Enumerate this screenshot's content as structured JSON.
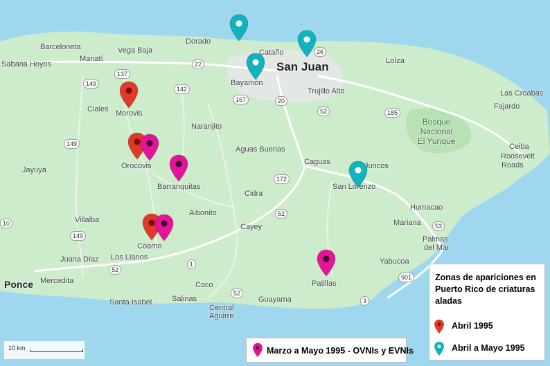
{
  "colors": {
    "sea": "#9fd8ee",
    "land": "#cdeccb",
    "road_major": "#ffffff",
    "road_minor": "#e8e8e8",
    "urban": "#e3e8e4",
    "pin_red": "#e0392b",
    "pin_magenta": "#e4139a",
    "pin_cyan": "#12b3c0"
  },
  "places": {
    "barceloneta": "Barceloneta",
    "vega_baja": "Vega Baja",
    "dorado": "Dorado",
    "manati": "Manatí",
    "sabana_hoyos": "Sabana Hoyos",
    "catano": "Cataño",
    "san_juan": "San Juan",
    "loiza": "Loíza",
    "bayamon": "Bayamón",
    "trujillo_alto": "Trujillo Alto",
    "las_croabas": "Las Croabas",
    "ciales": "Ciales",
    "morovis": "Morovis",
    "fajardo": "Fajardo",
    "naranjito": "Naranjito",
    "bosque_1": "Bosque",
    "bosque_2": "Nacional",
    "bosque_3": "El Yunque",
    "ceiba": "Ceiba",
    "roosevelt_1": "Roosevelt",
    "roosevelt_2": "Roads",
    "jayuya": "Jayuya",
    "orocovis": "Orocovis",
    "aguas_buenas": "Aguas Buenas",
    "caguas": "Caguas",
    "juncos": "Juncos",
    "barranquitas": "Barranquitas",
    "san_lorenzo": "San Lorenzo",
    "cidra": "Cidra",
    "aibonito": "Aibonito",
    "humacao": "Humacao",
    "villalba": "Villalba",
    "cayey": "Cayey",
    "mariana": "Mariana",
    "coamo": "Coamo",
    "palmas_1": "Palmas",
    "palmas_2": "del Mar",
    "juana_diaz": "Juana Díaz",
    "los_llanos": "Los Llanos",
    "yabucoa": "Yabucoa",
    "ponce": "Ponce",
    "mercedita": "Mercedita",
    "coco": "Coco",
    "patillas": "Patillas",
    "santa_isabel": "Santa Isabel",
    "salinas": "Salinas",
    "guayama": "Guayama",
    "central_1": "Central",
    "central_2": "Aguirre"
  },
  "shields": [
    "22",
    "26",
    "137",
    "149",
    "142",
    "167",
    "20",
    "52",
    "185",
    "149",
    "172",
    "52",
    "149",
    "52",
    "1",
    "53",
    "901",
    "3",
    "52",
    "10"
  ],
  "pins": {
    "red": [
      {
        "place": "Morovis",
        "period": "Abril 1995"
      },
      {
        "place": "Orocovis",
        "period": "Abril 1995"
      },
      {
        "place": "Coamo",
        "period": "Abril 1995"
      }
    ],
    "magenta": [
      {
        "place": "Orocovis",
        "period": "Marzo a Mayo 1995"
      },
      {
        "place": "Barranquitas",
        "period": "Marzo a Mayo 1995"
      },
      {
        "place": "Coamo",
        "period": "Marzo a Mayo 1995"
      },
      {
        "place": "Patillas",
        "period": "Marzo a Mayo 1995"
      }
    ],
    "cyan": [
      {
        "place": "Dorado coast",
        "period": "Abril a Mayo 1995"
      },
      {
        "place": "San Juan",
        "period": "Abril a Mayo 1995"
      },
      {
        "place": "Bayamón",
        "period": "Abril a Mayo 1995"
      },
      {
        "place": "San Lorenzo",
        "period": "Abril a Mayo 1995"
      }
    ]
  },
  "legend": {
    "title": "Zonas de apariciones en Puerto Rico de criaturas aladas",
    "red_label": "Abril 1995",
    "cyan_label": "Abril a Mayo 1995",
    "magenta_label": "Marzo a Mayo 1995 - OVNIs y EVNIs"
  },
  "scale": {
    "label": "10 km"
  }
}
